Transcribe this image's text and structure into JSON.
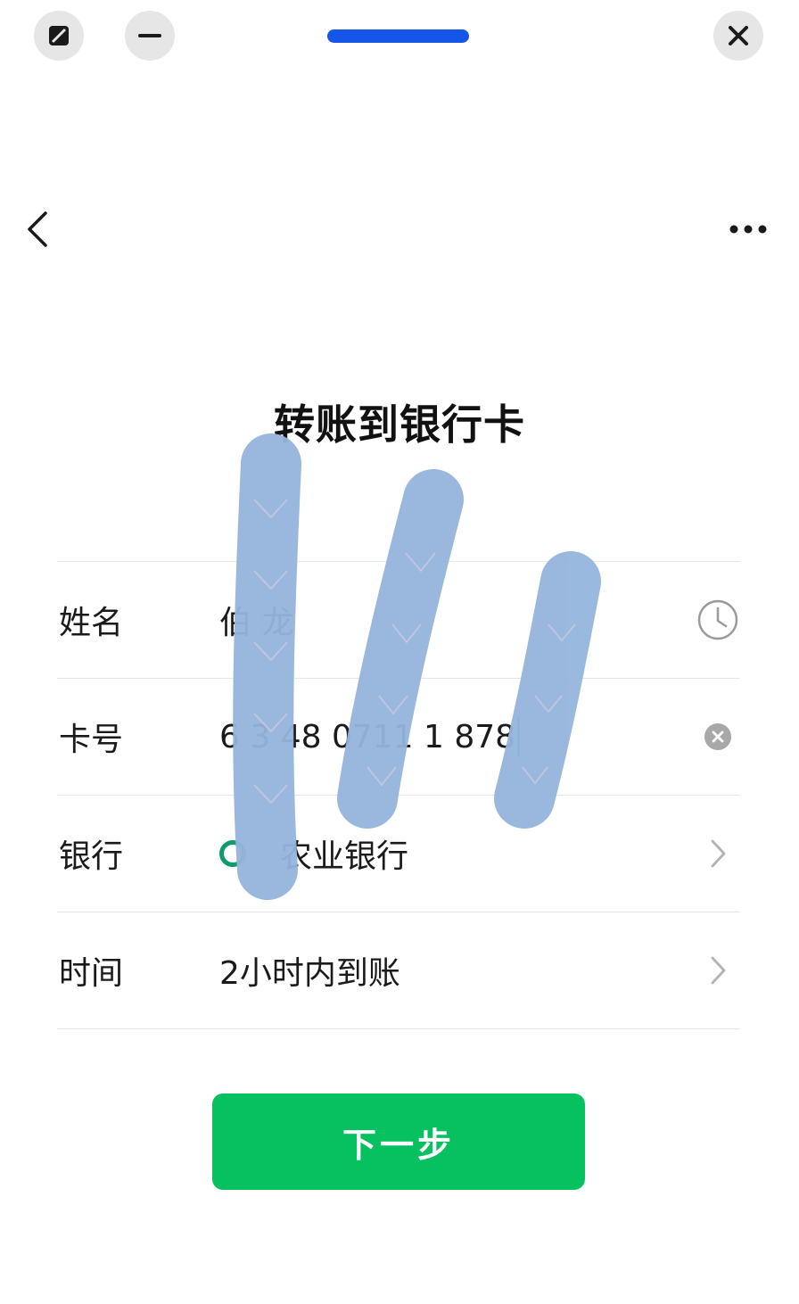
{
  "window": {
    "icons": [
      "expand-icon",
      "minimize-icon",
      "close-icon"
    ],
    "drag_bar_color": "#1356e8"
  },
  "nav": {
    "back_icon": "chevron-left-icon",
    "more_icon": "more-dots-icon"
  },
  "page": {
    "title": "转账到银行卡"
  },
  "form": {
    "name": {
      "label": "姓名",
      "value_visible": "伯 龙",
      "trail_icon": "clock-history-icon"
    },
    "card": {
      "label": "卡号",
      "value_visible": "6 3 48 0711 1 878",
      "trail_icon": "clear-icon"
    },
    "bank": {
      "label": "银行",
      "value_visible": "农业银行",
      "trail_icon": "chevron-right-icon"
    },
    "time": {
      "label": "时间",
      "value": "2小时内到账",
      "trail_icon": "chevron-right-icon"
    }
  },
  "actions": {
    "next_label": "下一步",
    "next_color": "#07c160"
  },
  "colors": {
    "accent": "#07c160",
    "redaction": "#95b5dc"
  }
}
